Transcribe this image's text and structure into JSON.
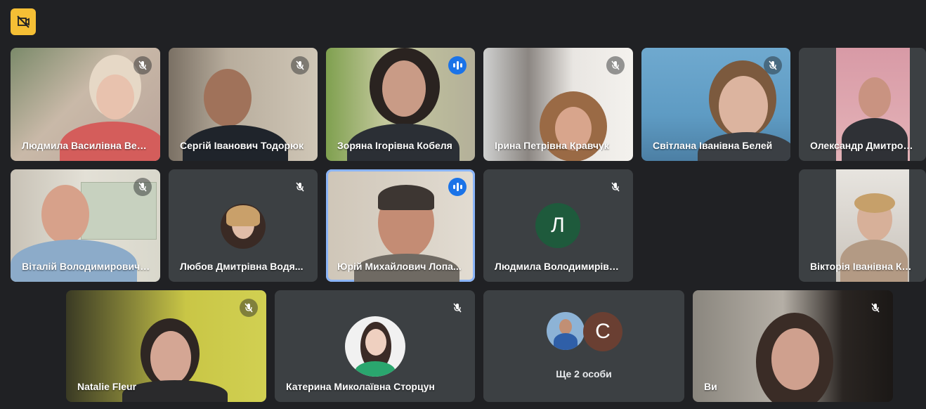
{
  "toolbar": {
    "icon": "hide-self-view-icon",
    "accent": "#f5bf35"
  },
  "participants": [
    {
      "name": "Людмила Василівна Вер..."
    },
    {
      "name": "Сергій Іванович Тодорюк"
    },
    {
      "name": "Зоряна Ігорівна Кобеля"
    },
    {
      "name": "Ірина Петрівна Кравчук"
    },
    {
      "name": "Світлана Іванівна Белей"
    },
    {
      "name": "Олександр Дмитрович ..."
    },
    {
      "name": "Віталій Володимирович ..."
    },
    {
      "name": "Любов Дмитрівна Водя..."
    },
    {
      "name": "Юрій Михайлович Лопа..."
    },
    {
      "name": "Людмила Володимирівн...",
      "initial": "Л"
    },
    {
      "name": "Вікторія Іванівна Кифяк"
    },
    {
      "name": "Natalie Fleur"
    },
    {
      "name": "Катерина Миколаївна Сторцун"
    },
    {
      "name": "Ще 2 особи",
      "initial": "С"
    },
    {
      "name": "Ви"
    }
  ]
}
